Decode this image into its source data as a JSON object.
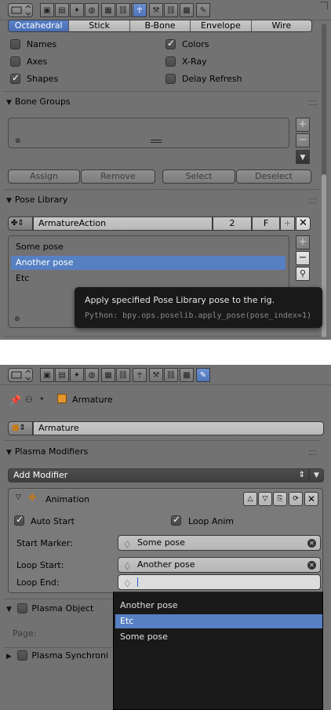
{
  "top_panel": {
    "display_modes": [
      {
        "label": "Octahedral",
        "selected": true
      },
      {
        "label": "Stick",
        "selected": false
      },
      {
        "label": "B-Bone",
        "selected": false
      },
      {
        "label": "Envelope",
        "selected": false
      },
      {
        "label": "Wire",
        "selected": false
      }
    ],
    "checkboxes": {
      "names": {
        "label": "Names",
        "checked": false
      },
      "colors": {
        "label": "Colors",
        "checked": true
      },
      "axes": {
        "label": "Axes",
        "checked": false
      },
      "xray": {
        "label": "X-Ray",
        "checked": false
      },
      "shapes": {
        "label": "Shapes",
        "checked": true
      },
      "delay_refresh": {
        "label": "Delay Refresh",
        "checked": false
      }
    },
    "bone_groups": {
      "title": "Bone Groups",
      "buttons": {
        "assign": "Assign",
        "remove": "Remove",
        "select": "Select",
        "deselect": "Deselect"
      }
    },
    "pose_library": {
      "title": "Pose Library",
      "action_name": "ArmatureAction",
      "users_count": "2",
      "fake_user": "F",
      "poses": [
        "Some pose",
        "Another pose",
        "Etc"
      ],
      "selected_pose": "Another pose"
    },
    "tooltip": {
      "title": "Apply specified Pose Library pose to the rig.",
      "python": "Python: bpy.ops.poselib.apply_pose(pose_index=1)"
    }
  },
  "bottom_panel": {
    "breadcrumb": {
      "object": "Armature"
    },
    "datablock_name": "Armature",
    "plasma_modifiers": {
      "title": "Plasma Modifiers",
      "add_modifier": "Add Modifier",
      "animation": {
        "title": "Animation",
        "auto_start": {
          "label": "Auto Start",
          "checked": true
        },
        "loop_anim": {
          "label": "Loop Anim",
          "checked": true
        },
        "start_marker": {
          "label": "Start Marker:",
          "value": "Some pose"
        },
        "loop_start": {
          "label": "Loop Start:",
          "value": "Another pose"
        },
        "loop_end": {
          "label": "Loop End:",
          "value": ""
        }
      }
    },
    "plasma_object": {
      "title": "Plasma Object",
      "page_label": "Page:"
    },
    "plasma_synchronization": {
      "title": "Plasma Synchroni"
    },
    "dropdown": {
      "items": [
        "Another pose",
        "Etc",
        "Some pose"
      ],
      "selected": "Etc"
    }
  },
  "colors": {
    "panel_bg": "#727272",
    "selected_blue": "#5680c2",
    "tooltip_bg": "#191919"
  }
}
